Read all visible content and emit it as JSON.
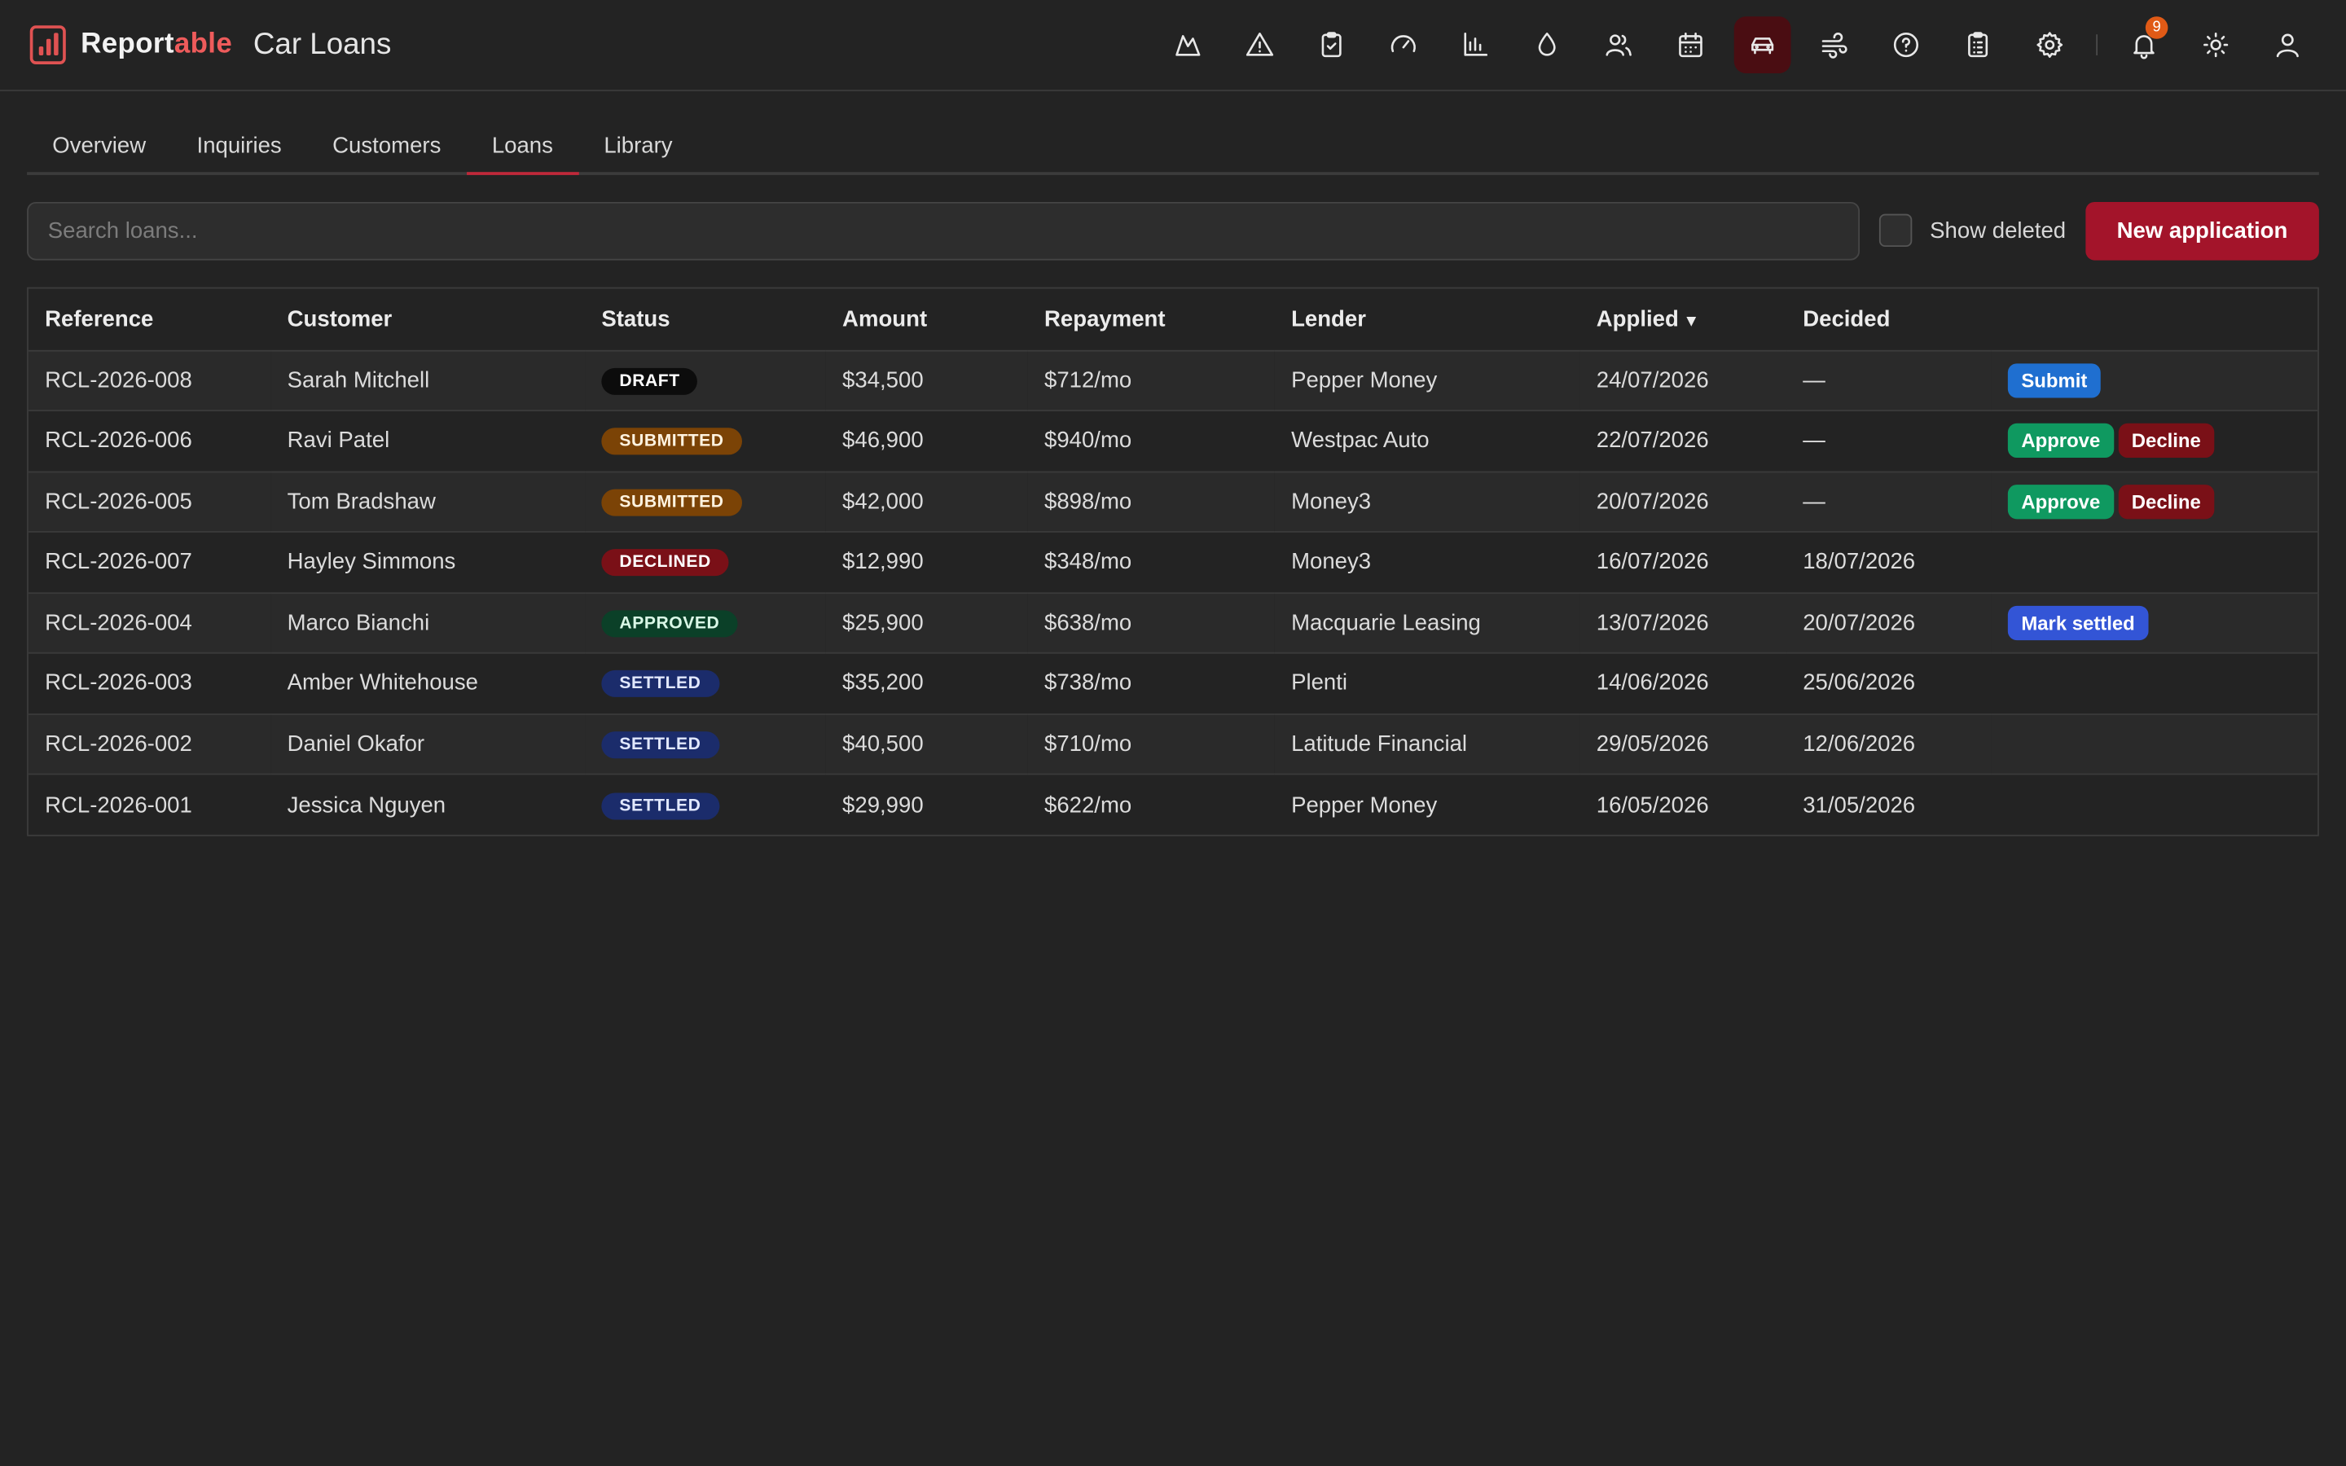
{
  "header": {
    "brand_main": "Report",
    "brand_accent": "able",
    "app_title": "Car Loans",
    "icons": [
      {
        "name": "mountain-icon"
      },
      {
        "name": "warning-icon"
      },
      {
        "name": "clipboard-check-icon"
      },
      {
        "name": "gauge-icon"
      },
      {
        "name": "bar-chart-icon"
      },
      {
        "name": "droplet-icon"
      },
      {
        "name": "users-icon"
      },
      {
        "name": "calendar-icon"
      },
      {
        "name": "car-icon",
        "active": true
      },
      {
        "name": "wind-icon"
      },
      {
        "name": "help-icon"
      },
      {
        "name": "clipboard-list-icon"
      },
      {
        "name": "gear-icon"
      }
    ],
    "notification_count": "9",
    "accent_color": "#ee5b5b",
    "active_icon_bg": "#4a0d12"
  },
  "tabs": [
    {
      "label": "Overview"
    },
    {
      "label": "Inquiries"
    },
    {
      "label": "Customers"
    },
    {
      "label": "Loans",
      "active": true
    },
    {
      "label": "Library"
    }
  ],
  "toolbar": {
    "search_placeholder": "Search loans...",
    "show_deleted_label": "Show deleted",
    "new_button_label": "New application"
  },
  "table": {
    "columns": {
      "reference": "Reference",
      "customer": "Customer",
      "status": "Status",
      "amount": "Amount",
      "repayment": "Repayment",
      "lender": "Lender",
      "applied": "Applied",
      "decided": "Decided"
    },
    "sort_indicator": "▼",
    "rows": [
      {
        "reference": "RCL-2026-008",
        "customer": "Sarah Mitchell",
        "status": "DRAFT",
        "amount": "$34,500",
        "repayment": "$712/mo",
        "lender": "Pepper Money",
        "applied": "24/07/2026",
        "decided": "—",
        "actions": [
          "Submit"
        ]
      },
      {
        "reference": "RCL-2026-006",
        "customer": "Ravi Patel",
        "status": "SUBMITTED",
        "amount": "$46,900",
        "repayment": "$940/mo",
        "lender": "Westpac Auto",
        "applied": "22/07/2026",
        "decided": "—",
        "actions": [
          "Approve",
          "Decline"
        ]
      },
      {
        "reference": "RCL-2026-005",
        "customer": "Tom Bradshaw",
        "status": "SUBMITTED",
        "amount": "$42,000",
        "repayment": "$898/mo",
        "lender": "Money3",
        "applied": "20/07/2026",
        "decided": "—",
        "actions": [
          "Approve",
          "Decline"
        ]
      },
      {
        "reference": "RCL-2026-007",
        "customer": "Hayley Simmons",
        "status": "DECLINED",
        "amount": "$12,990",
        "repayment": "$348/mo",
        "lender": "Money3",
        "applied": "16/07/2026",
        "decided": "18/07/2026",
        "actions": []
      },
      {
        "reference": "RCL-2026-004",
        "customer": "Marco Bianchi",
        "status": "APPROVED",
        "amount": "$25,900",
        "repayment": "$638/mo",
        "lender": "Macquarie Leasing",
        "applied": "13/07/2026",
        "decided": "20/07/2026",
        "actions": [
          "Mark settled"
        ]
      },
      {
        "reference": "RCL-2026-003",
        "customer": "Amber Whitehouse",
        "status": "SETTLED",
        "amount": "$35,200",
        "repayment": "$738/mo",
        "lender": "Plenti",
        "applied": "14/06/2026",
        "decided": "25/06/2026",
        "actions": []
      },
      {
        "reference": "RCL-2026-002",
        "customer": "Daniel Okafor",
        "status": "SETTLED",
        "amount": "$40,500",
        "repayment": "$710/mo",
        "lender": "Latitude Financial",
        "applied": "29/05/2026",
        "decided": "12/06/2026",
        "actions": []
      },
      {
        "reference": "RCL-2026-001",
        "customer": "Jessica Nguyen",
        "status": "SETTLED",
        "amount": "$29,990",
        "repayment": "$622/mo",
        "lender": "Pepper Money",
        "applied": "16/05/2026",
        "decided": "31/05/2026",
        "actions": []
      }
    ]
  }
}
